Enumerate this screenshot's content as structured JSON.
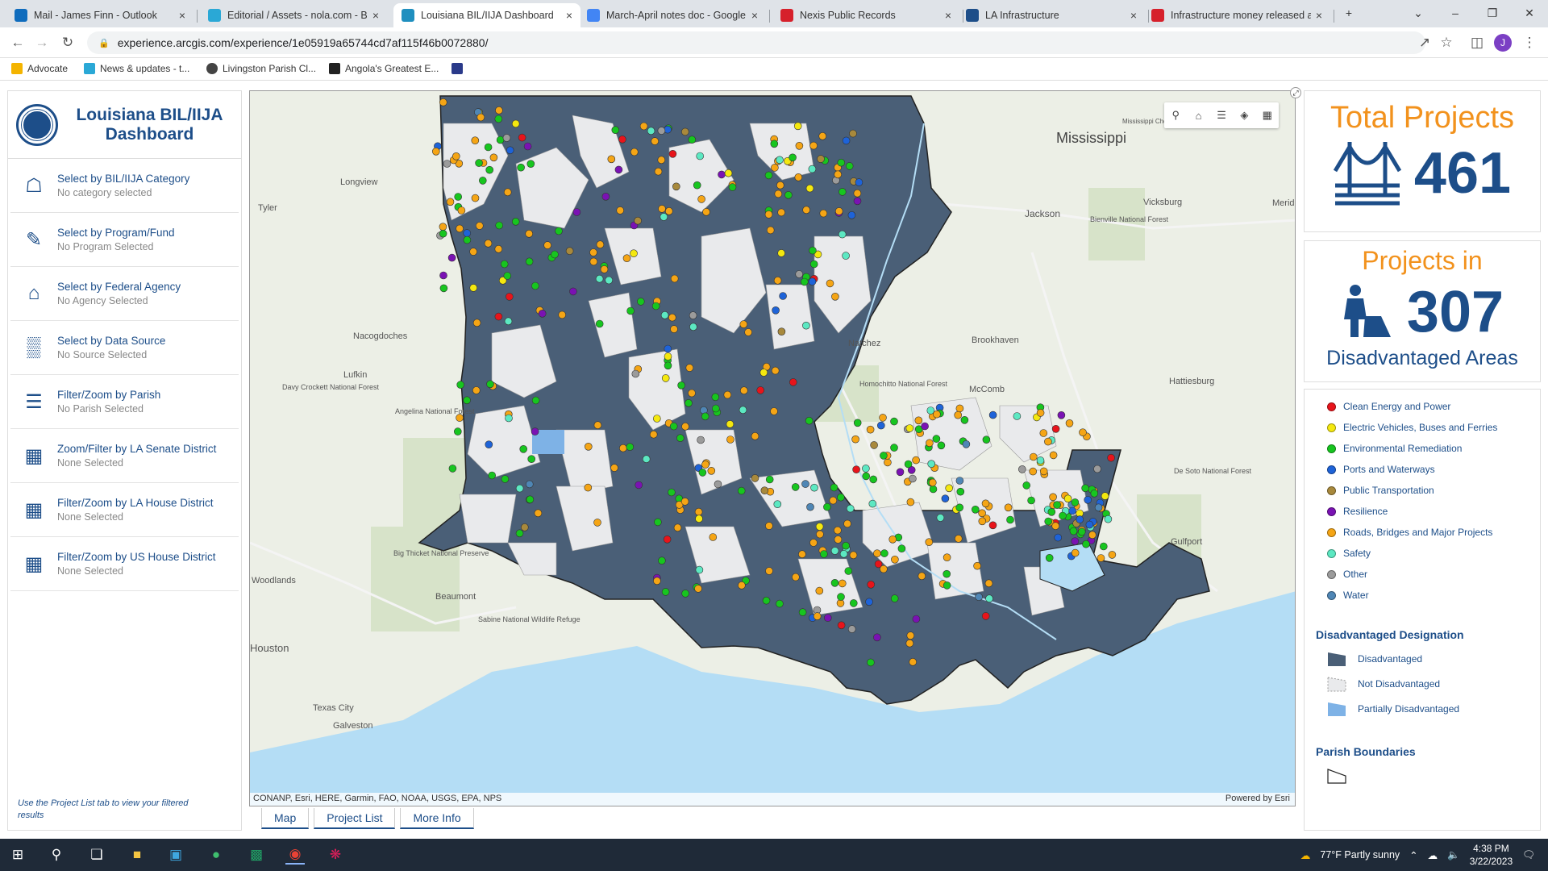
{
  "browser": {
    "tabs": [
      {
        "title": "Mail - James Finn - Outlook",
        "color": "#0f6cbd"
      },
      {
        "title": "Editorial / Assets - nola.com - Bl",
        "color": "#2aa8d6"
      },
      {
        "title": "Louisiana BIL/IIJA Dashboard",
        "color": "#1f8fbf"
      },
      {
        "title": "March-April notes doc - Google",
        "color": "#4285f4"
      },
      {
        "title": "Nexis Public Records",
        "color": "#d6202b"
      },
      {
        "title": "LA Infrastructure",
        "color": "#1d4e89"
      },
      {
        "title": "Infrastructure money released a",
        "color": "#d6202b"
      }
    ],
    "url": "experience.arcgis.com/experience/1e05919a65744cd7af115f46b0072880/",
    "bookmarks": [
      "Advocate",
      "News & updates - t...",
      "Livingston Parish Cl...",
      "Angola's Greatest E..."
    ]
  },
  "dashboard": {
    "title": "Louisiana BIL/IIJA Dashboard",
    "filters": [
      {
        "label": "Select by BIL/IIJA Category",
        "value": "No category selected"
      },
      {
        "label": "Select by Program/Fund",
        "value": "No Program Selected"
      },
      {
        "label": "Select by Federal Agency",
        "value": "No Agency Selected"
      },
      {
        "label": "Select by Data Source",
        "value": "No Source Selected"
      },
      {
        "label": "Filter/Zoom by Parish",
        "value": "No Parish Selected"
      },
      {
        "label": "Zoom/Filter by LA Senate District",
        "value": "None Selected"
      },
      {
        "label": "Filter/Zoom by LA House District",
        "value": "None Selected"
      },
      {
        "label": "Filter/Zoom by US House District",
        "value": "None Selected"
      }
    ],
    "footer_note": "Use the Project List tab to view your filtered results"
  },
  "map": {
    "attribution": "CONANP, Esri, HERE, Garmin, FAO, NOAA, USGS, EPA, NPS",
    "powered_by": "Powered by Esri",
    "place_labels": [
      {
        "t": "Mississippi",
        "big": true
      },
      {
        "t": "Vicksburg"
      },
      {
        "t": "Jackson"
      },
      {
        "t": "Meridian"
      },
      {
        "t": "Natchez"
      },
      {
        "t": "Brookhaven"
      },
      {
        "t": "McComb"
      },
      {
        "t": "Hattiesburg"
      },
      {
        "t": "Gulfport"
      },
      {
        "t": "Tyler"
      },
      {
        "t": "Longview"
      },
      {
        "t": "Nacogdoches"
      },
      {
        "t": "Lufkin"
      },
      {
        "t": "Beaumont"
      },
      {
        "t": "Houston"
      },
      {
        "t": "Texas City"
      },
      {
        "t": "Galveston"
      },
      {
        "t": "Woodlands"
      },
      {
        "t": "Homochitto National Forest"
      },
      {
        "t": "Bienville National Forest"
      },
      {
        "t": "De Soto National Forest"
      },
      {
        "t": "Angelina National Forest"
      },
      {
        "t": "Big Thicket National Preserve"
      },
      {
        "t": "Davy Crockett National Forest"
      },
      {
        "t": "Sabine National Wildlife Refuge"
      },
      {
        "t": "Mississippi Choctaw Reservation"
      }
    ],
    "tabs": [
      "Map",
      "Project List",
      "More Info"
    ]
  },
  "kpis": {
    "total_label": "Total Projects",
    "total_value": "461",
    "disadv_label_top": "Projects in",
    "disadv_value": "307",
    "disadv_label_bottom": "Disadvantaged Areas"
  },
  "legend": {
    "categories": [
      {
        "label": "Clean Energy and Power",
        "color": "#e8141b"
      },
      {
        "label": "Electric Vehicles, Buses and Ferries",
        "color": "#f4e80f"
      },
      {
        "label": "Environmental Remediation",
        "color": "#17c51f"
      },
      {
        "label": "Ports and Waterways",
        "color": "#1e63d8"
      },
      {
        "label": "Public Transportation",
        "color": "#a8893c"
      },
      {
        "label": "Resilience",
        "color": "#7a12b3"
      },
      {
        "label": "Roads, Bridges and Major Projects",
        "color": "#f5a515"
      },
      {
        "label": "Safety",
        "color": "#5ce8c2"
      },
      {
        "label": "Other",
        "color": "#9b9b9b"
      },
      {
        "label": "Water",
        "color": "#4f86b5"
      }
    ],
    "designation_title": "Disadvantaged Designation",
    "designations": [
      {
        "label": "Disadvantaged",
        "color": "#4a5f77"
      },
      {
        "label": "Not Disadvantaged",
        "color": "#e9eaec"
      },
      {
        "label": "Partially Disadvantaged",
        "color": "#7eb2e6"
      }
    ],
    "boundaries_title": "Parish Boundaries"
  },
  "taskbar": {
    "weather": "77°F  Partly sunny",
    "time": "4:38 PM",
    "date": "3/22/2023"
  }
}
